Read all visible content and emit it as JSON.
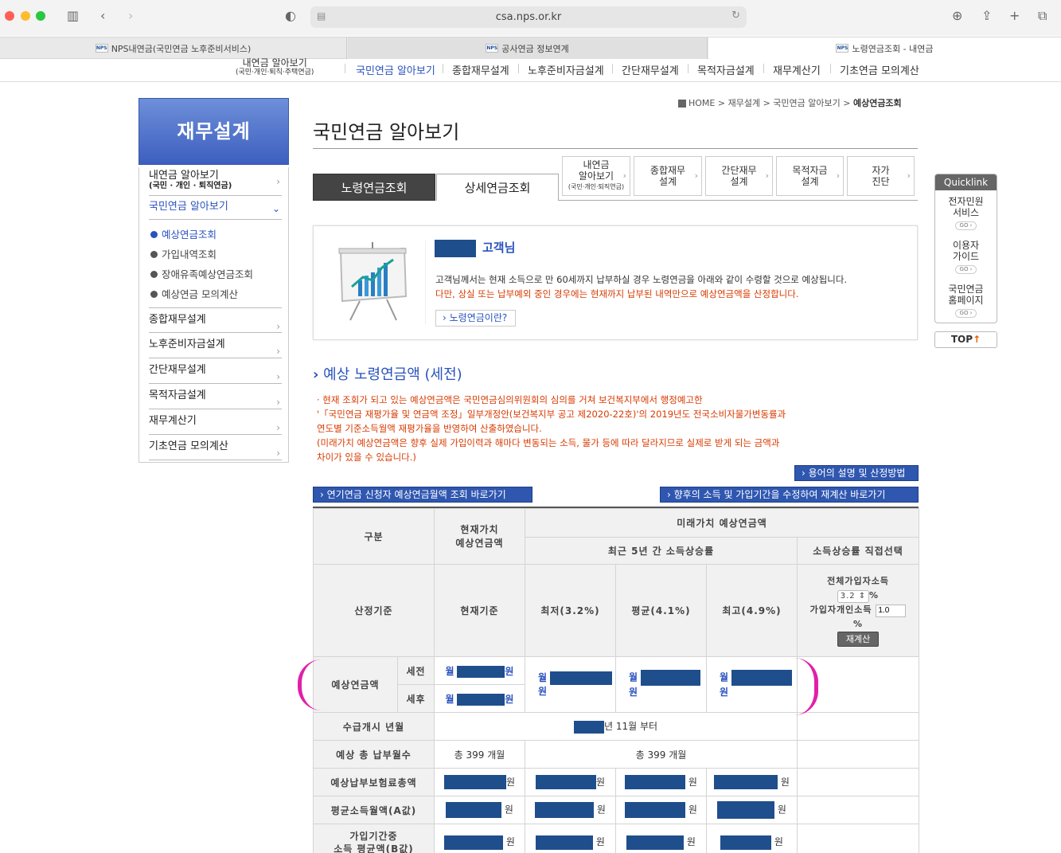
{
  "browser": {
    "url": "csa.nps.or.kr",
    "tabs": [
      "NPS내연금(국민연금 노후준비서비스)",
      "공사연금 정보연계",
      "노령연금조회 - 내연금"
    ]
  },
  "topnav": {
    "first": "내연금 알아보기",
    "first_sub": "(국민·개인·퇴직·주택연금)",
    "items": [
      "국민연금 알아보기",
      "종합재무설계",
      "노후준비자금설계",
      "간단재무설계",
      "목적자금설계",
      "재무계산기",
      "기초연금 모의계산"
    ]
  },
  "sidebar": {
    "title": "재무설계",
    "item1": "내연금 알아보기",
    "item1_sub": "(국민 · 개인  · 퇴직연금)",
    "active": "국민연금 알아보기",
    "subs": [
      "예상연금조회",
      "가입내역조회",
      "장애유족예상연금조회",
      "예상연금 모의계산"
    ],
    "items": [
      "종합재무설계",
      "노후준비자금설계",
      "간단재무설계",
      "목적자금설계",
      "재무계산기",
      "기초연금 모의계산"
    ]
  },
  "crumb": {
    "home": "HOME",
    "path": "> 재무설계 > 국민연금 알아보기 >",
    "current": "예상연금조회"
  },
  "page_title": "국민연금 알아보기",
  "tabs": {
    "on": "노령연금조회",
    "off": "상세연금조회"
  },
  "minitabs": [
    {
      "l1": "내연금",
      "l2": "알아보기",
      "l3": "(국민·개인·퇴직연금)"
    },
    {
      "l1": "종합재무",
      "l2": "설계"
    },
    {
      "l1": "간단재무",
      "l2": "설계"
    },
    {
      "l1": "목적자금",
      "l2": "설계"
    },
    {
      "l1": "자가",
      "l2": "진단"
    }
  ],
  "info": {
    "customer": "고객님",
    "line1": "고객님께서는 현재 소득으로 만 60세까지 납부하실 경우 노령연금을 아래와 같이 수령할 것으로 예상됩니다.",
    "line2": "다만, 상실 또는 납부예외 중인 경우에는 현재까지 납부된 내역만으로 예상연금액을 산정합니다.",
    "button": "› 노령연금이란?"
  },
  "section_title": "예상 노령연금액 (세전)",
  "notice": [
    "· 현재 조회가 되고 있는 예상연금액은 국민연금심의위원회의 심의를 거쳐 보건복지부에서 행정예고한",
    "  '「국민연금 재평가율 및 연금액 조정」일부개정안(보건복지부 공고 제2020-22호)'의 2019년도 전국소비자물가변동률과",
    "  연도별 기준소득월액 재평가율을 반영하여 산출하였습니다.",
    "  (미래가치 예상연금액은 향후 실제 가입이력과 해마다 변동되는 소득, 물가 등에 따라 달라지므로 실제로 받게 되는 금액과",
    "  차이가 있을 수 있습니다.)"
  ],
  "buttons": {
    "terms": "› 용어의 설명 및 산정방법",
    "deferred": "› 연기연금 신청자 예상연금월액 조회 바로가기",
    "recalc_link": "› 향후의 소득 및 가입기간을 수정하여 재계산 바로가기"
  },
  "table": {
    "h_gubun": "구분",
    "h_current": "현재가치\n예상연금액",
    "h_future": "미래가치 예상연금액",
    "h_recent": "최근 5년 간 소득상승률",
    "h_direct": "소득상승률 직접선택",
    "basis": "산정기준",
    "cur_basis": "현재기준",
    "low": "최저(3.2%)",
    "avg": "평균(4.1%)",
    "high": "최고(4.9%)",
    "all_income": "전체가입자소득",
    "rate_value": "3.2",
    "pct": "%",
    "personal_income": "가입자개인소득",
    "personal_value": "1.0",
    "recalc": "재계산",
    "expected": "예상연금액",
    "pretax": "세전",
    "aftertax": "세후",
    "month": "월",
    "won": "원",
    "start": "수급개시 년월",
    "start_val": "년 11월 부터",
    "months_label": "예상 총 납부월수",
    "months_val": "총 399 개월",
    "premium": "예상납부보험료총액",
    "avg_a": "평균소득월액(A값)",
    "avg_b1": "가입기간중",
    "avg_b2": "소득 평균액(B값)"
  },
  "quicklink": {
    "title": "Quicklink",
    "items": [
      "전자민원\n서비스",
      "이용자\n가이드",
      "국민연금\n홈페이지"
    ],
    "go": "GO ›",
    "top": "TOP"
  }
}
